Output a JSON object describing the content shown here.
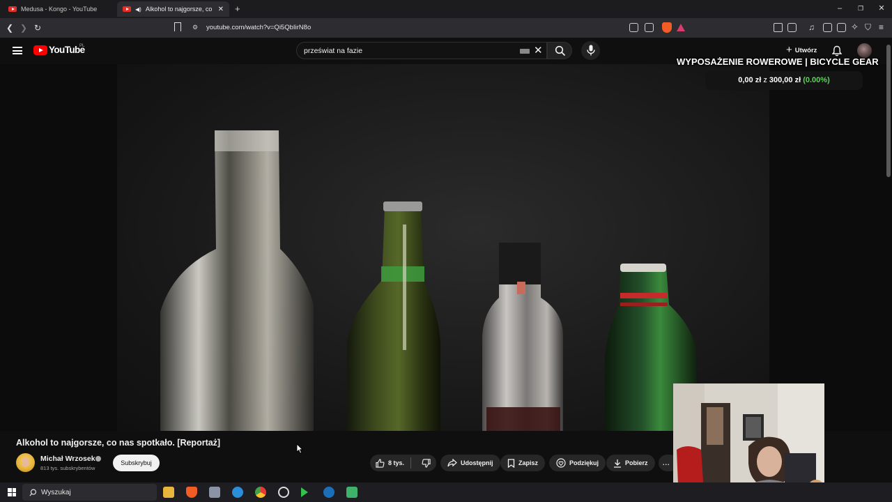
{
  "browser": {
    "tabs": [
      {
        "label": "Medusa - Kongo - YouTube",
        "active": false
      },
      {
        "label": "Alkohol to najgorsze, co nas s",
        "active": true
      }
    ],
    "new_tab_label": "+",
    "url": "youtube.com/watch?v=Qi5QbIirN8o"
  },
  "youtube": {
    "wordmark": "YouTube",
    "region": "PL",
    "search_value": "przeświat na fazie",
    "create_label": "Utwórz"
  },
  "overlay": {
    "title": "WYPOSAŻENIE ROWEROWE | BICYCLE GEAR",
    "current": "0,00 zł",
    "between": "z",
    "goal": "300,00 zł",
    "percent": "(0.00%)",
    "percent_color": "#5ad657"
  },
  "video": {
    "title": "Alkohol to najgorsze, co nas spotkało. [Reportaż]",
    "channel_name": "Michał Wrzosek",
    "subscribers": "813 tys. subskrybentów",
    "subscribe_label": "Subskrybuj",
    "likes": "8 tys.",
    "share_label": "Udostępnij",
    "save_label": "Zapisz",
    "thanks_label": "Podziękuj",
    "download_label": "Pobierz",
    "more_label": "..."
  },
  "taskbar": {
    "search_label": "Wyszukaj"
  },
  "icons": [
    "youtube-icon",
    "back-icon",
    "forward-icon",
    "reload-icon",
    "bookmark-icon",
    "search-icon",
    "mic-icon",
    "bell-icon",
    "like-icon",
    "dislike-icon",
    "share-icon",
    "save-icon",
    "thanks-icon",
    "download-icon",
    "windows-icon"
  ]
}
